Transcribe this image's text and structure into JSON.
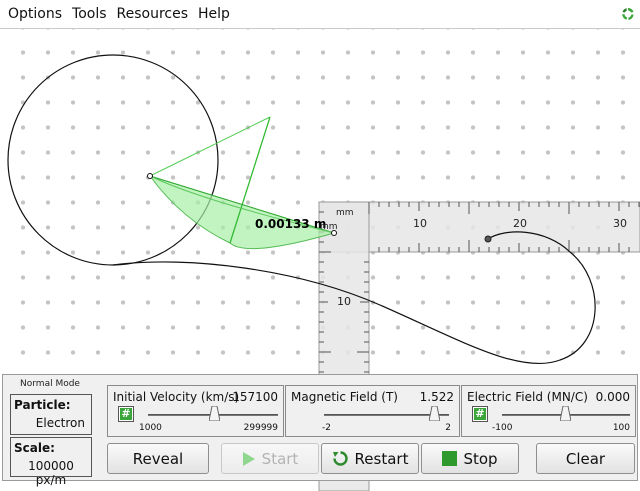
{
  "menu": {
    "items": [
      "Options",
      "Tools",
      "Resources",
      "Help"
    ],
    "logo_icon": "phet-logo-icon"
  },
  "canvas": {
    "measurement_label": "0.00133 m",
    "ruler": {
      "unit_label": "mm",
      "horizontal_ticks": [
        "10",
        "20",
        "30"
      ],
      "vertical_ticks": [
        "10"
      ]
    }
  },
  "panel": {
    "mode_label": "Normal Mode",
    "particle": {
      "title": "Particle:",
      "value": "Electron"
    },
    "scale": {
      "title": "Scale:",
      "value": "100000 px/m"
    },
    "sliders": [
      {
        "label": "Initial Velocity (km/s)",
        "value": "157100",
        "min": "1000",
        "max": "299999",
        "fraction": 0.52
      },
      {
        "label": "Magnetic Field (T)",
        "value": "1.522",
        "min": "-2",
        "max": "2",
        "fraction": 0.88
      },
      {
        "label": "Electric Field (MN/C)",
        "value": "0.000",
        "min": "-100",
        "max": "100",
        "fraction": 0.5
      }
    ],
    "buttons": {
      "reveal": "Reveal",
      "start": "Start",
      "restart": "Restart",
      "stop": "Stop",
      "clear": "Clear"
    }
  },
  "colors": {
    "accent_green": "#3aa63a",
    "protractor_fill": "#a6f0a6"
  }
}
